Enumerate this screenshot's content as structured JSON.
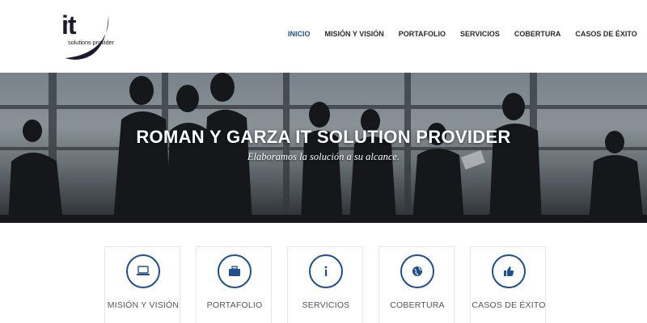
{
  "brand": {
    "logo_mark": "it",
    "logo_tagline": "solutions provider",
    "accent_color": "#1f4f8f"
  },
  "nav": {
    "items": [
      {
        "label": "INICIO",
        "active": true
      },
      {
        "label": "MISIÓN Y VISIÓN",
        "active": false
      },
      {
        "label": "PORTAFOLIO",
        "active": false
      },
      {
        "label": "SERVICIOS",
        "active": false
      },
      {
        "label": "COBERTURA",
        "active": false
      },
      {
        "label": "CASOS DE ÉXITO",
        "active": false
      }
    ]
  },
  "hero": {
    "title": "ROMAN Y GARZA IT SOLUTION PROVIDER",
    "subtitle": "Elaboramos la solución a su alcance."
  },
  "features": [
    {
      "label": "MISIÓN Y VISIÓN",
      "icon": "laptop-icon"
    },
    {
      "label": "PORTAFOLIO",
      "icon": "briefcase-icon"
    },
    {
      "label": "SERVICIOS",
      "icon": "info-icon"
    },
    {
      "label": "COBERTURA",
      "icon": "globe-icon"
    },
    {
      "label": "CASOS DE ÉXITO",
      "icon": "thumbs-up-icon"
    }
  ]
}
